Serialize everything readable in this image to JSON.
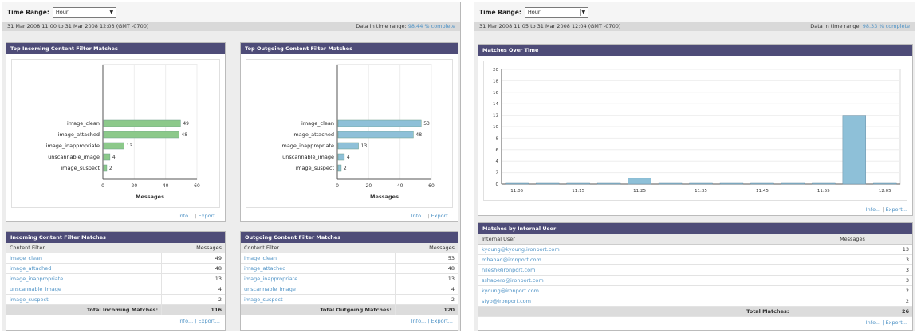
{
  "left": {
    "time_range_label": "Time Range:",
    "time_range_value": "Hour",
    "date_range": "31 Mar 2008 11:00 to 31 Mar 2008 12:03 (GMT -0700)",
    "data_range_label": "Data in time range:",
    "data_range_value": "98.44 % complete",
    "incoming_chart_title": "Top Incoming Content Filter Matches",
    "outgoing_chart_title": "Top Outgoing Content Filter Matches",
    "incoming_table_title": "Incoming Content Filter Matches",
    "outgoing_table_title": "Outgoing Content Filter Matches",
    "col_filter": "Content Filter",
    "col_messages": "Messages",
    "incoming_rows": [
      {
        "name": "image_clean",
        "count": "49"
      },
      {
        "name": "image_attached",
        "count": "48"
      },
      {
        "name": "image_inappropriate",
        "count": "13"
      },
      {
        "name": "unscannable_image",
        "count": "4"
      },
      {
        "name": "image_suspect",
        "count": "2"
      }
    ],
    "outgoing_rows": [
      {
        "name": "image_clean",
        "count": "53"
      },
      {
        "name": "image_attached",
        "count": "48"
      },
      {
        "name": "image_inappropriate",
        "count": "13"
      },
      {
        "name": "unscannable_image",
        "count": "4"
      },
      {
        "name": "image_suspect",
        "count": "2"
      }
    ],
    "incoming_total_label": "Total Incoming Matches:",
    "incoming_total": "116",
    "outgoing_total_label": "Total Outgoing Matches:",
    "outgoing_total": "120"
  },
  "right": {
    "time_range_label": "Time Range:",
    "time_range_value": "Hour",
    "date_range": "31 Mar 2008 11:05 to 31 Mar 2008 12:04 (GMT -0700)",
    "data_range_label": "Data in time range:",
    "data_range_value": "98.33 % complete",
    "chart_title": "Matches Over Time",
    "table_title": "Matches by Internal User",
    "col_user": "Internal User",
    "col_messages": "Messages",
    "rows": [
      {
        "user": "kyoung@kyoung.ironport.com",
        "count": "13"
      },
      {
        "user": "mhahad@ironport.com",
        "count": "3"
      },
      {
        "user": "nilesh@ironport.com",
        "count": "3"
      },
      {
        "user": "sshapero@ironport.com",
        "count": "3"
      },
      {
        "user": "kyoung@ironport.com",
        "count": "2"
      },
      {
        "user": "styo@ironport.com",
        "count": "2"
      }
    ],
    "total_label": "Total Matches:",
    "total": "26"
  },
  "links": {
    "info": "Info...",
    "sep": "|",
    "export": "Export..."
  },
  "colors": {
    "header": "#4e4c78",
    "green_bar": "#8cc98a",
    "blue_bar": "#8ec0d8",
    "link": "#4f93c6"
  },
  "chart_data": [
    {
      "type": "bar",
      "orientation": "horizontal",
      "title": "Top Incoming Content Filter Matches",
      "categories": [
        "image_clean",
        "image_attached",
        "image_inappropriate",
        "unscannable_image",
        "image_suspect"
      ],
      "values": [
        49,
        48,
        13,
        4,
        2
      ],
      "xlabel": "Messages",
      "xlim": [
        0,
        60
      ],
      "xticks": [
        "0",
        "20",
        "40",
        "60"
      ],
      "color": "#8cc98a"
    },
    {
      "type": "bar",
      "orientation": "horizontal",
      "title": "Top Outgoing Content Filter Matches",
      "categories": [
        "image_clean",
        "image_attached",
        "image_inappropriate",
        "unscannable_image",
        "image_suspect"
      ],
      "values": [
        53,
        48,
        13,
        4,
        2
      ],
      "xlabel": "Messages",
      "xlim": [
        0,
        60
      ],
      "xticks": [
        "0",
        "20",
        "40",
        "60"
      ],
      "color": "#8ec0d8"
    },
    {
      "type": "bar",
      "orientation": "vertical",
      "title": "Matches Over Time",
      "categories": [
        "11:05",
        "11:10",
        "11:15",
        "11:20",
        "11:25",
        "11:30",
        "11:35",
        "11:40",
        "11:45",
        "11:50",
        "11:55",
        "12:00",
        "12:05"
      ],
      "tick_labels": [
        "11:05",
        "",
        "11:15",
        "",
        "11:25",
        "",
        "11:35",
        "",
        "11:45",
        "",
        "11:55",
        "",
        "12:05"
      ],
      "values": [
        0,
        0,
        0,
        0,
        1,
        0,
        0,
        0,
        0,
        0,
        0,
        12,
        0
      ],
      "ylim": [
        0,
        20
      ],
      "yticks": [
        "0",
        "2",
        "4",
        "6",
        "8",
        "10",
        "12",
        "14",
        "16",
        "18",
        "20"
      ],
      "color": "#8ec0d8"
    }
  ]
}
